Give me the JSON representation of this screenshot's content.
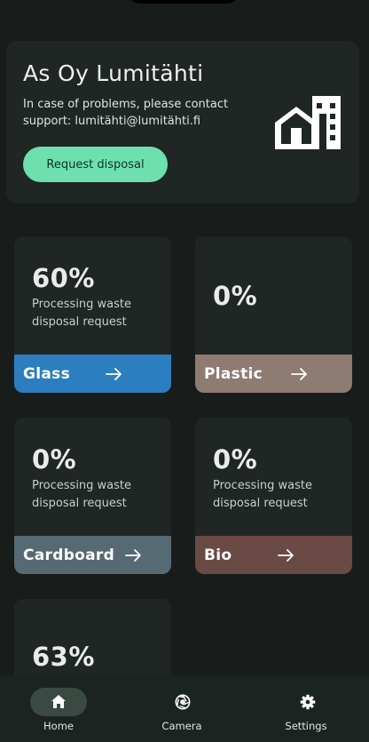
{
  "header": {
    "title": "As Oy Lumitähti",
    "description": "In case of problems, please contact support: lumitähti@lumitähti.fi",
    "request_button_label": "Request disposal",
    "icon": "building-icon"
  },
  "tiles": [
    {
      "name": "Glass",
      "percent_text": "60%",
      "progress": 0.6,
      "status": "Processing waste disposal request",
      "bar_color": "#2b7fc0"
    },
    {
      "name": "Plastic",
      "percent_text": "0%",
      "progress": 0.0,
      "status": "",
      "bar_color": "#8e7b72"
    },
    {
      "name": "Cardboard",
      "percent_text": "0%",
      "progress": 0.0,
      "status": "Processing waste disposal request",
      "bar_color": "#566a74"
    },
    {
      "name": "Bio",
      "percent_text": "0%",
      "progress": 0.0,
      "status": "Processing waste disposal request",
      "bar_color": "#6a4a44"
    },
    {
      "name": "",
      "percent_text": "63%",
      "progress": 0.63,
      "status": "",
      "bar_color": ""
    }
  ],
  "nav": {
    "items": [
      {
        "label": "Home",
        "icon": "home-icon",
        "active": true
      },
      {
        "label": "Camera",
        "icon": "camera-aperture-icon",
        "active": false
      },
      {
        "label": "Settings",
        "icon": "gear-icon",
        "active": false
      }
    ]
  },
  "colors": {
    "accent": "#6ee0b0",
    "card_background": "#1f2623",
    "screen_background": "#181c1b",
    "nav_background": "#1c2421"
  }
}
